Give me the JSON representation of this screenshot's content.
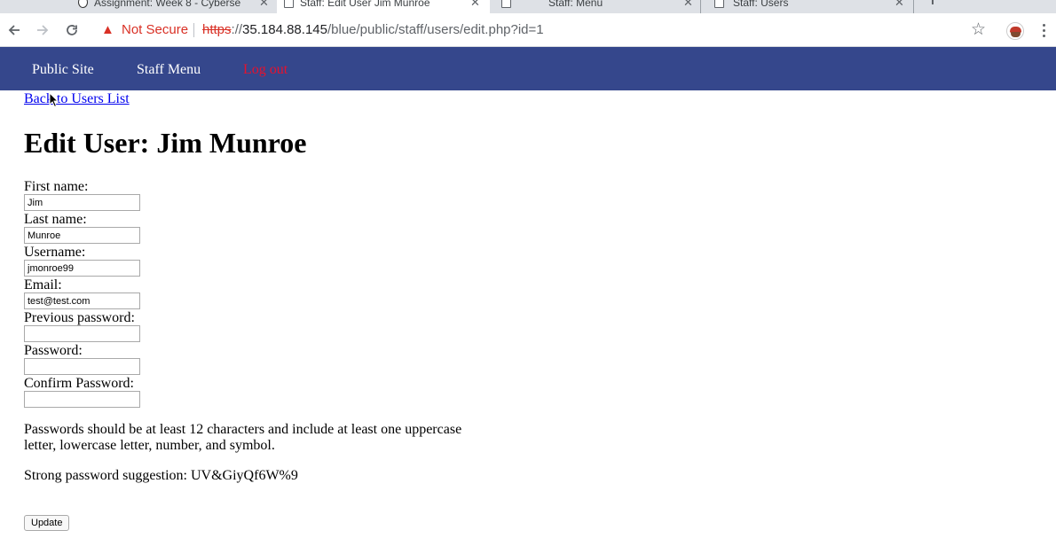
{
  "browser": {
    "tabs": [
      {
        "title": "Assignment: Week 8 - Cyberse",
        "active": false
      },
      {
        "title": "Staff: Edit User Jim Munroe",
        "active": true
      },
      {
        "title": "Staff: Menu",
        "active": false
      },
      {
        "title": "Staff: Users",
        "active": false
      }
    ],
    "security_label": "Not Secure",
    "url": {
      "scheme": "https",
      "separator": "://",
      "host": "35.184.88.145",
      "path": "/blue/public/staff/users/edit.php?id=1"
    },
    "icons": {
      "back": "arrow-left-icon",
      "forward": "arrow-right-icon",
      "reload": "reload-icon",
      "security": "warning-triangle-icon",
      "bookmark": "star-icon",
      "menu": "three-dots-icon"
    }
  },
  "navbar": {
    "links": [
      {
        "label": "Public Site"
      },
      {
        "label": "Staff Menu"
      },
      {
        "label": "Log out"
      }
    ],
    "colors": {
      "background": "#35478c",
      "link": "#ffffff",
      "logout": "#e8112d"
    }
  },
  "page": {
    "back_link": "Back to Users List",
    "title": "Edit User: Jim Munroe",
    "form": {
      "fields": [
        {
          "label": "First name:",
          "value": "Jim"
        },
        {
          "label": "Last name:",
          "value": "Munroe"
        },
        {
          "label": "Username:",
          "value": "jmonroe99"
        },
        {
          "label": "Email:",
          "value": "test@test.com"
        },
        {
          "label": "Previous password:",
          "value": ""
        },
        {
          "label": "Password:",
          "value": ""
        },
        {
          "label": "Confirm Password:",
          "value": ""
        }
      ],
      "password_hint": "Passwords should be at least 12 characters and include at least one uppercase letter, lowercase letter, number, and symbol.",
      "suggestion": "Strong password suggestion: UV&GiyQf6W%9",
      "submit_label": "Update"
    }
  }
}
